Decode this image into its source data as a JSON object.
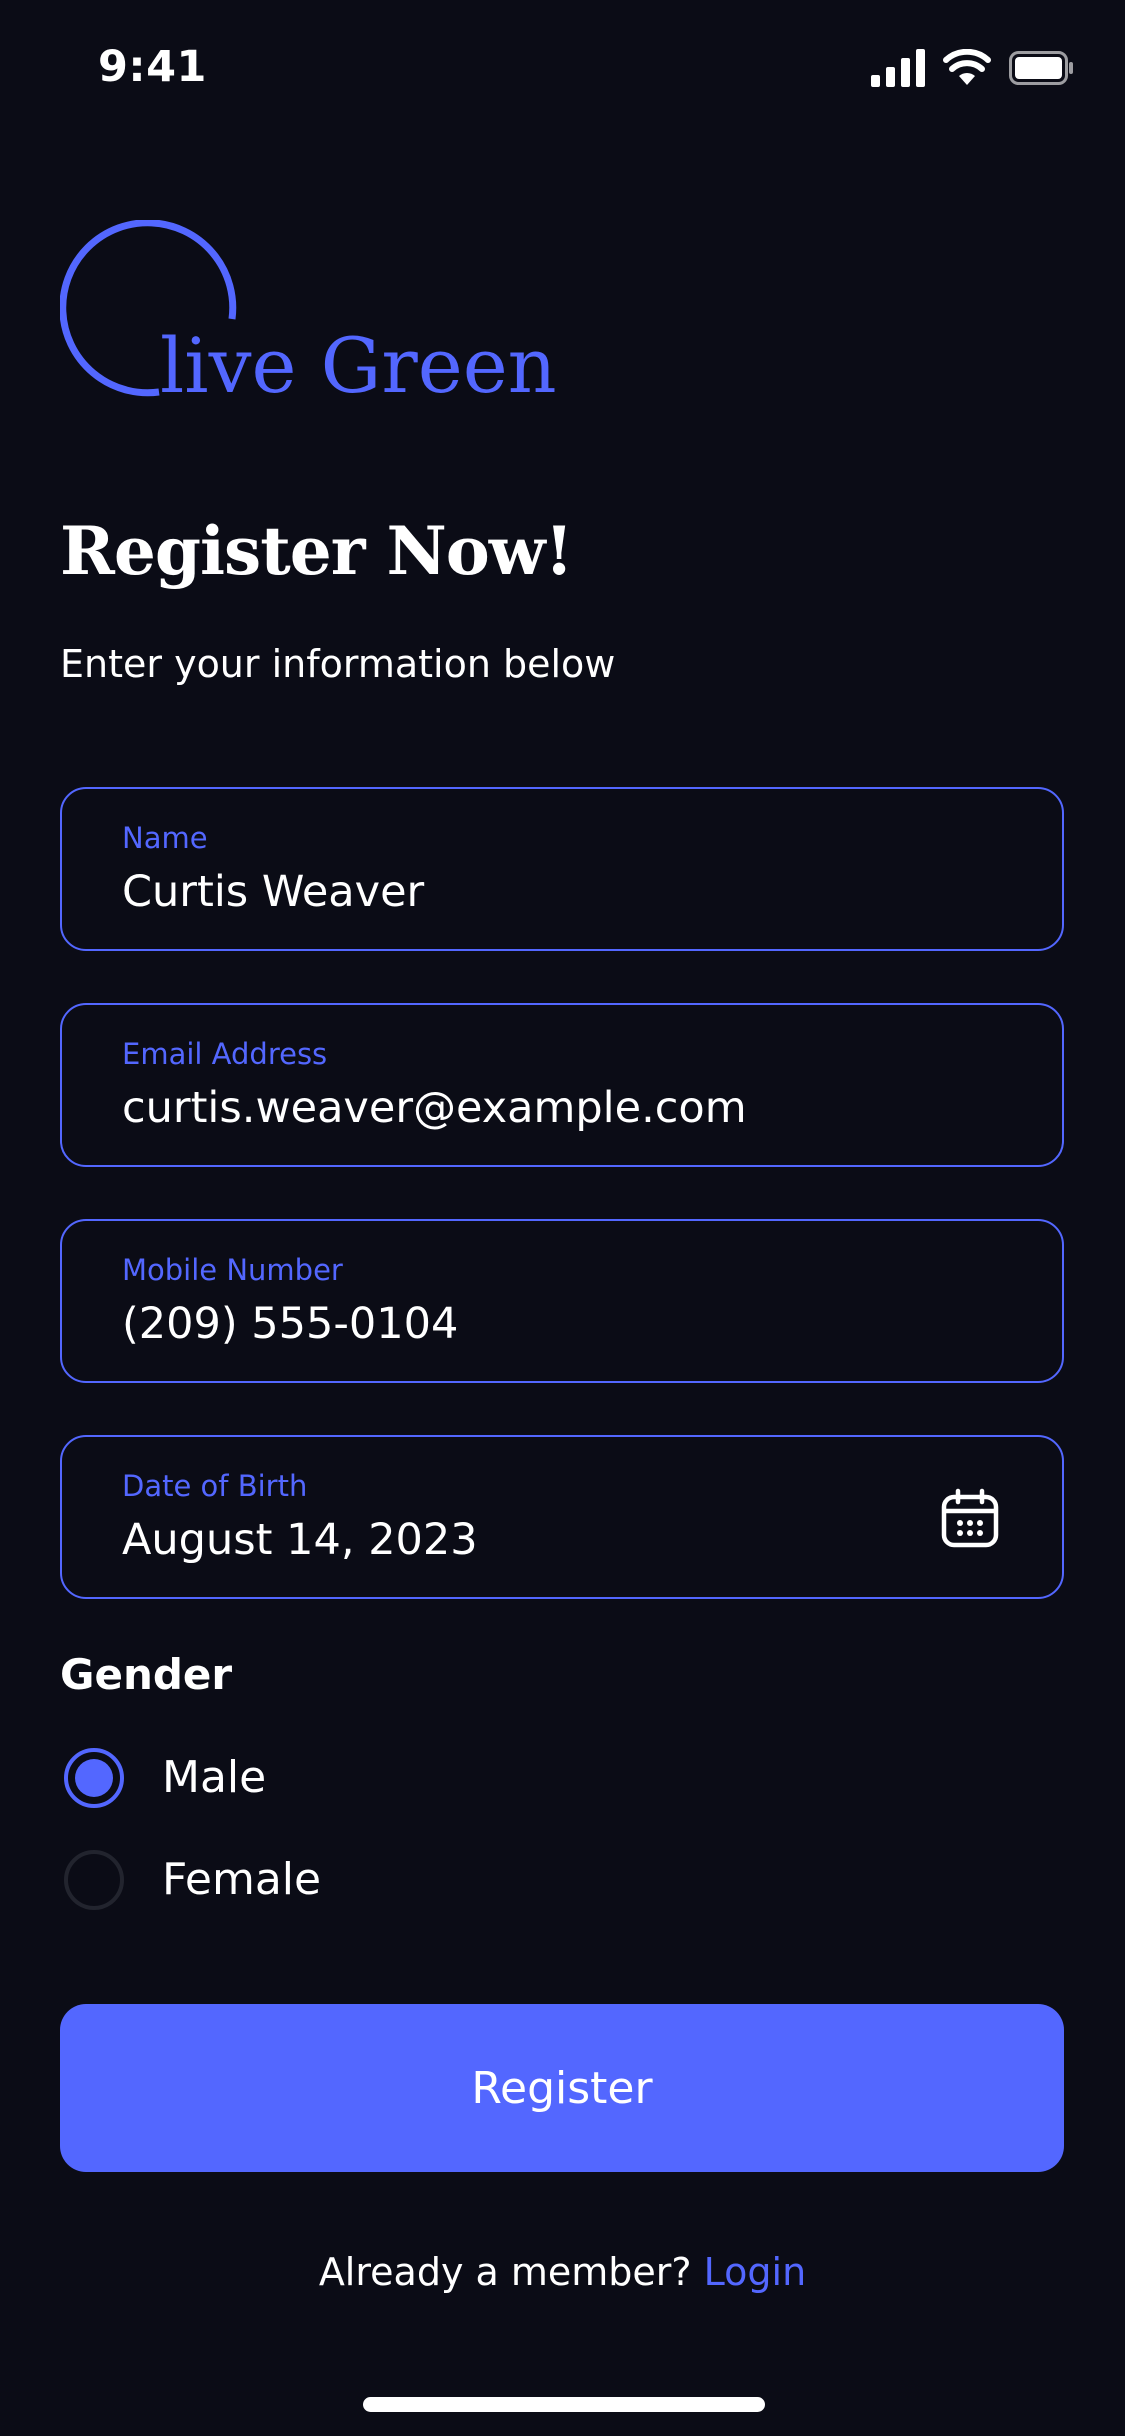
{
  "status_bar": {
    "time": "9:41",
    "icons": [
      "signal-icon",
      "wifi-icon",
      "battery-icon"
    ]
  },
  "brand": {
    "name": "live Green",
    "accent_color": "#5367ff"
  },
  "header": {
    "title": "Register Now!",
    "subtitle": "Enter your information below"
  },
  "form": {
    "name": {
      "label": "Name",
      "value": "Curtis Weaver"
    },
    "email": {
      "label": "Email Address",
      "value": "curtis.weaver@example.com"
    },
    "mobile": {
      "label": "Mobile Number",
      "value": "(209) 555-0104"
    },
    "dob": {
      "label": "Date of Birth",
      "value": "August 14, 2023",
      "icon": "calendar-icon"
    },
    "gender": {
      "label": "Gender",
      "options": [
        {
          "label": "Male",
          "selected": true
        },
        {
          "label": "Female",
          "selected": false
        }
      ]
    }
  },
  "actions": {
    "register_label": "Register",
    "login_prompt": "Already a member?",
    "login_link": "Login"
  },
  "colors": {
    "background": "#0b0c16",
    "accent": "#5367ff",
    "text": "#ffffff"
  }
}
